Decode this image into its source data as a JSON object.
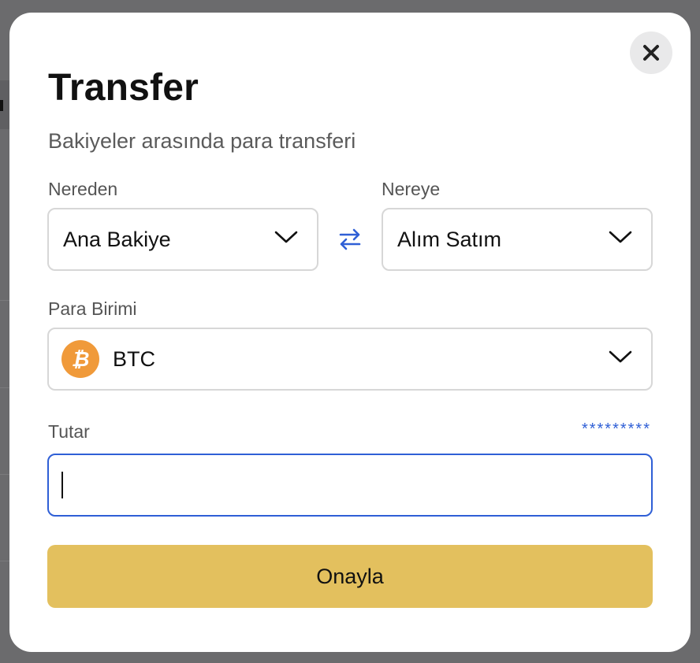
{
  "modal": {
    "title": "Transfer",
    "subtitle": "Bakiyeler arasında para transferi",
    "close_icon": "close-icon"
  },
  "from": {
    "label": "Nereden",
    "value": "Ana Bakiye"
  },
  "to": {
    "label": "Nereye",
    "value": "Alım Satım"
  },
  "swap_icon": "swap-arrows-icon",
  "currency": {
    "label": "Para Birimi",
    "value": "BTC",
    "icon": "bitcoin-icon",
    "icon_color": "#f09a3a"
  },
  "amount": {
    "label": "Tutar",
    "balance_masked": "*********",
    "value": ""
  },
  "confirm_label": "Onayla",
  "colors": {
    "accent": "#2f5fd6",
    "confirm_button": "#e3c05e"
  }
}
